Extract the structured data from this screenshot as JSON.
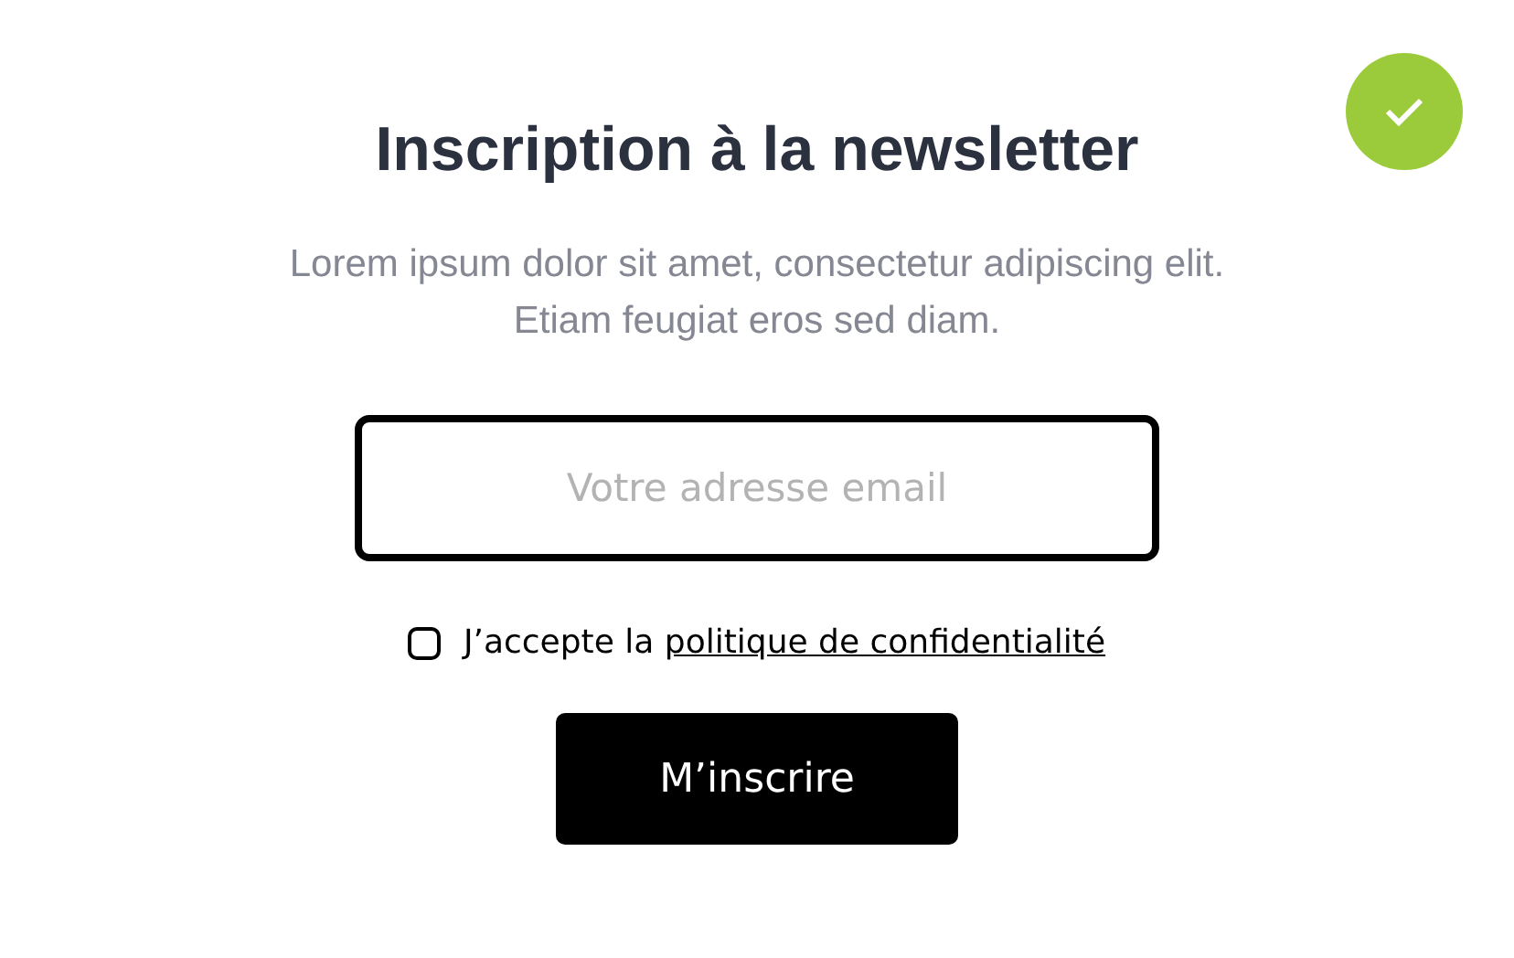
{
  "title": "Inscription à la newsletter",
  "description": "Lorem ipsum dolor sit amet, consectetur adipiscing elit. Etiam feugiat eros sed diam.",
  "email_field": {
    "placeholder": "Votre adresse email"
  },
  "consent": {
    "checked": false,
    "text": "J’accepte la ",
    "link": "politique de confidentialité"
  },
  "submit_button": "M’inscrire"
}
